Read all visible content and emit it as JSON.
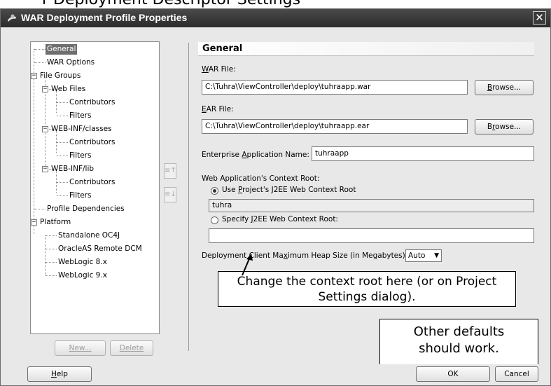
{
  "top_fragment": "r Deployment Descriptor Settings",
  "window": {
    "title": "WAR Deployment Profile Properties",
    "close_glyph": "✕"
  },
  "tree": {
    "items": [
      {
        "label": "General"
      },
      {
        "label": "WAR Options"
      },
      {
        "label": "File Groups"
      },
      {
        "label": "Web Files"
      },
      {
        "label": "Contributors"
      },
      {
        "label": "Filters"
      },
      {
        "label": "WEB-INF/classes"
      },
      {
        "label": "Contributors"
      },
      {
        "label": "Filters"
      },
      {
        "label": "WEB-INF/lib"
      },
      {
        "label": "Contributors"
      },
      {
        "label": "Filters"
      },
      {
        "label": "Profile Dependencies"
      },
      {
        "label": "Platform"
      },
      {
        "label": "Standalone OC4J"
      },
      {
        "label": "OracleAS Remote DCM"
      },
      {
        "label": "WebLogic 8.x"
      },
      {
        "label": "WebLogic 9.x"
      }
    ],
    "selected": "General",
    "new_button": "New...",
    "delete_button": "Delete"
  },
  "panel": {
    "header": "General",
    "war_label_key": "W",
    "war_label_rest": "AR File:",
    "war_value": "C:\\Tuhra\\ViewController\\deploy\\tuhraapp.war",
    "browse_label_key": "B",
    "browse_label_rest": "rowse...",
    "ear_label_key": "E",
    "ear_label_rest": "AR File:",
    "ear_value": "C:\\Tuhra\\ViewController\\deploy\\tuhraapp.ear",
    "browse2_label_pre": "B",
    "browse2_label_key": "r",
    "browse2_label_rest": "owse...",
    "ent_label_pre": "Enterprise ",
    "ent_label_key": "A",
    "ent_label_rest": "pplication Name:",
    "ent_value": "tuhraapp",
    "context_label": "Web Application's Context Root:",
    "radio1_pre": "Use ",
    "radio1_key": "P",
    "radio1_rest": "roject's J2EE Web Context Root",
    "context_value": "tuhra",
    "radio2_pre": "Specify ",
    "radio2_key": "J",
    "radio2_rest": "2EE Web Context Root:",
    "specify_value": "",
    "heap_label_pre": "Deployment Client Ma",
    "heap_label_key": "x",
    "heap_label_rest": "imum Heap Size (in Megabytes):",
    "heap_value": "Auto"
  },
  "callouts": {
    "context_note": "Change the context root here (or on Project Settings dialog).",
    "defaults_note": "Other defaults should work."
  },
  "footer": {
    "help_key": "H",
    "help_rest": "elp",
    "ok": "OK",
    "cancel": "Cancel"
  }
}
